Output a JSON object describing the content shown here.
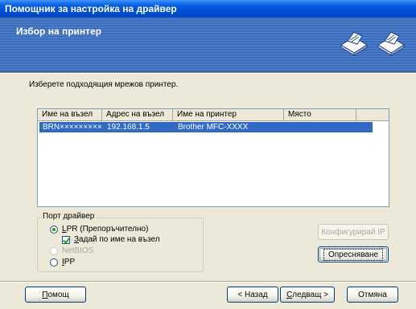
{
  "window": {
    "title": "Помощник за настройка на драйвер"
  },
  "header": {
    "title": "Избор на принтер",
    "icons": [
      "printer-network-icon",
      "printer-network-icon"
    ]
  },
  "instruction": "Изберете подходящия мрежов принтер.",
  "printer_list": {
    "columns": [
      "Име на възел",
      "Адрес на възел",
      "Име на принтер",
      "Място"
    ],
    "rows": [
      {
        "node_name": "BRN×××××××××",
        "node_address": "192.168.1.5",
        "printer_name": "Brother MFC-XXXX",
        "location": ""
      }
    ]
  },
  "driver_port": {
    "label": "Порт драйвер",
    "options": [
      {
        "label": "LPR (Препоръчително)",
        "selected": true,
        "enabled": true
      },
      {
        "label": "NetBIOS",
        "selected": false,
        "enabled": false
      },
      {
        "label": "IPP",
        "selected": false,
        "enabled": true
      }
    ],
    "checkbox": {
      "label": "Задай по име на възел",
      "checked": true
    }
  },
  "buttons": {
    "configure_ip": "Конфигурирай IP",
    "refresh": "Опресняване",
    "help": "Помощ",
    "back": "< Назад",
    "next": "Следващ >",
    "cancel": "Отмяна"
  }
}
